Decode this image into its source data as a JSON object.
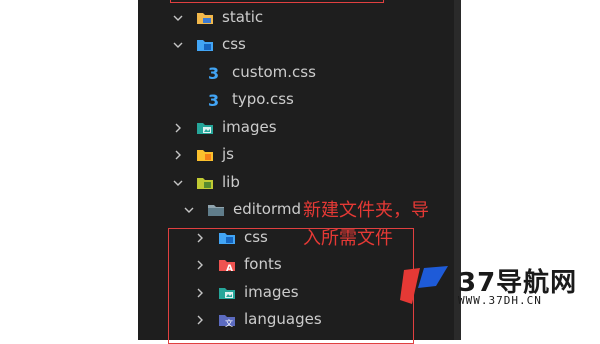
{
  "explorer": {
    "rows": [
      {
        "label": "static",
        "icon": "folder-static-icon",
        "expanded": true
      },
      {
        "label": "css",
        "icon": "folder-css-icon",
        "expanded": true
      },
      {
        "label": "custom.css",
        "icon": "css-file-icon"
      },
      {
        "label": "typo.css",
        "icon": "css-file-icon"
      },
      {
        "label": "images",
        "icon": "folder-images-icon",
        "expanded": false
      },
      {
        "label": "js",
        "icon": "folder-js-icon",
        "expanded": false
      },
      {
        "label": "lib",
        "icon": "folder-lib-icon",
        "expanded": true
      },
      {
        "label": "editormd",
        "icon": "folder-icon",
        "expanded": true
      },
      {
        "label": "css",
        "icon": "folder-css-icon",
        "expanded": false
      },
      {
        "label": "fonts",
        "icon": "folder-fonts-icon",
        "expanded": false
      },
      {
        "label": "images",
        "icon": "folder-images-icon",
        "expanded": false
      },
      {
        "label": "languages",
        "icon": "folder-languages-icon",
        "expanded": false
      }
    ]
  },
  "annotation": {
    "line1": "新建文件夹，导",
    "line2": "入所需文件"
  },
  "watermark": {
    "title": "37导航网",
    "url": "WWW.37DH.CN"
  },
  "colors": {
    "background": "#1e1e1e",
    "text": "#cccccc",
    "annotation": "#e53935",
    "highlight_box": "#e04040"
  }
}
